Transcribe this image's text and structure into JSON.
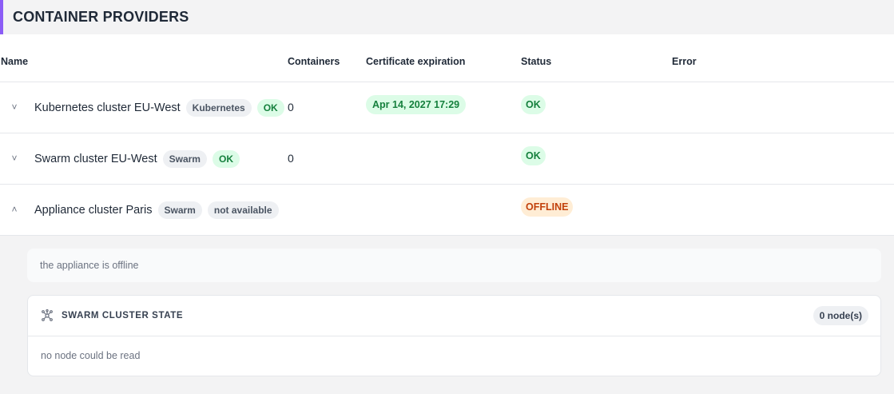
{
  "header": {
    "title": "CONTAINER PROVIDERS"
  },
  "table": {
    "columns": {
      "name": "Name",
      "containers": "Containers",
      "certificate": "Certificate expiration",
      "status": "Status",
      "error": "Error"
    },
    "rows": [
      {
        "chevron": "˅",
        "name": "Kubernetes cluster EU-West",
        "type_tag": "Kubernetes",
        "state_tag": "OK",
        "containers": "0",
        "certificate": "Apr 14, 2027 17:29",
        "status": "OK",
        "error": ""
      },
      {
        "chevron": "˅",
        "name": "Swarm cluster EU-West",
        "type_tag": "Swarm",
        "state_tag": "OK",
        "containers": "0",
        "certificate": "",
        "status": "OK",
        "error": ""
      },
      {
        "chevron": "˄",
        "name": "Appliance cluster Paris",
        "type_tag": "Swarm",
        "state_tag": "not available",
        "containers": "",
        "certificate": "",
        "status": "OFFLINE",
        "error": ""
      }
    ]
  },
  "details": {
    "error_message": "the appliance is offline",
    "cluster_state": {
      "icon": "cluster-network-icon",
      "title": "SWARM CLUSTER STATE",
      "node_count": "0 node(s)",
      "message": "no node could be read"
    }
  },
  "colors": {
    "accent": "#8b5cf6",
    "ok_bg": "#dcfce7",
    "ok_text": "#15803d",
    "offline_bg": "#ffedd5",
    "offline_text": "#c2410c"
  }
}
